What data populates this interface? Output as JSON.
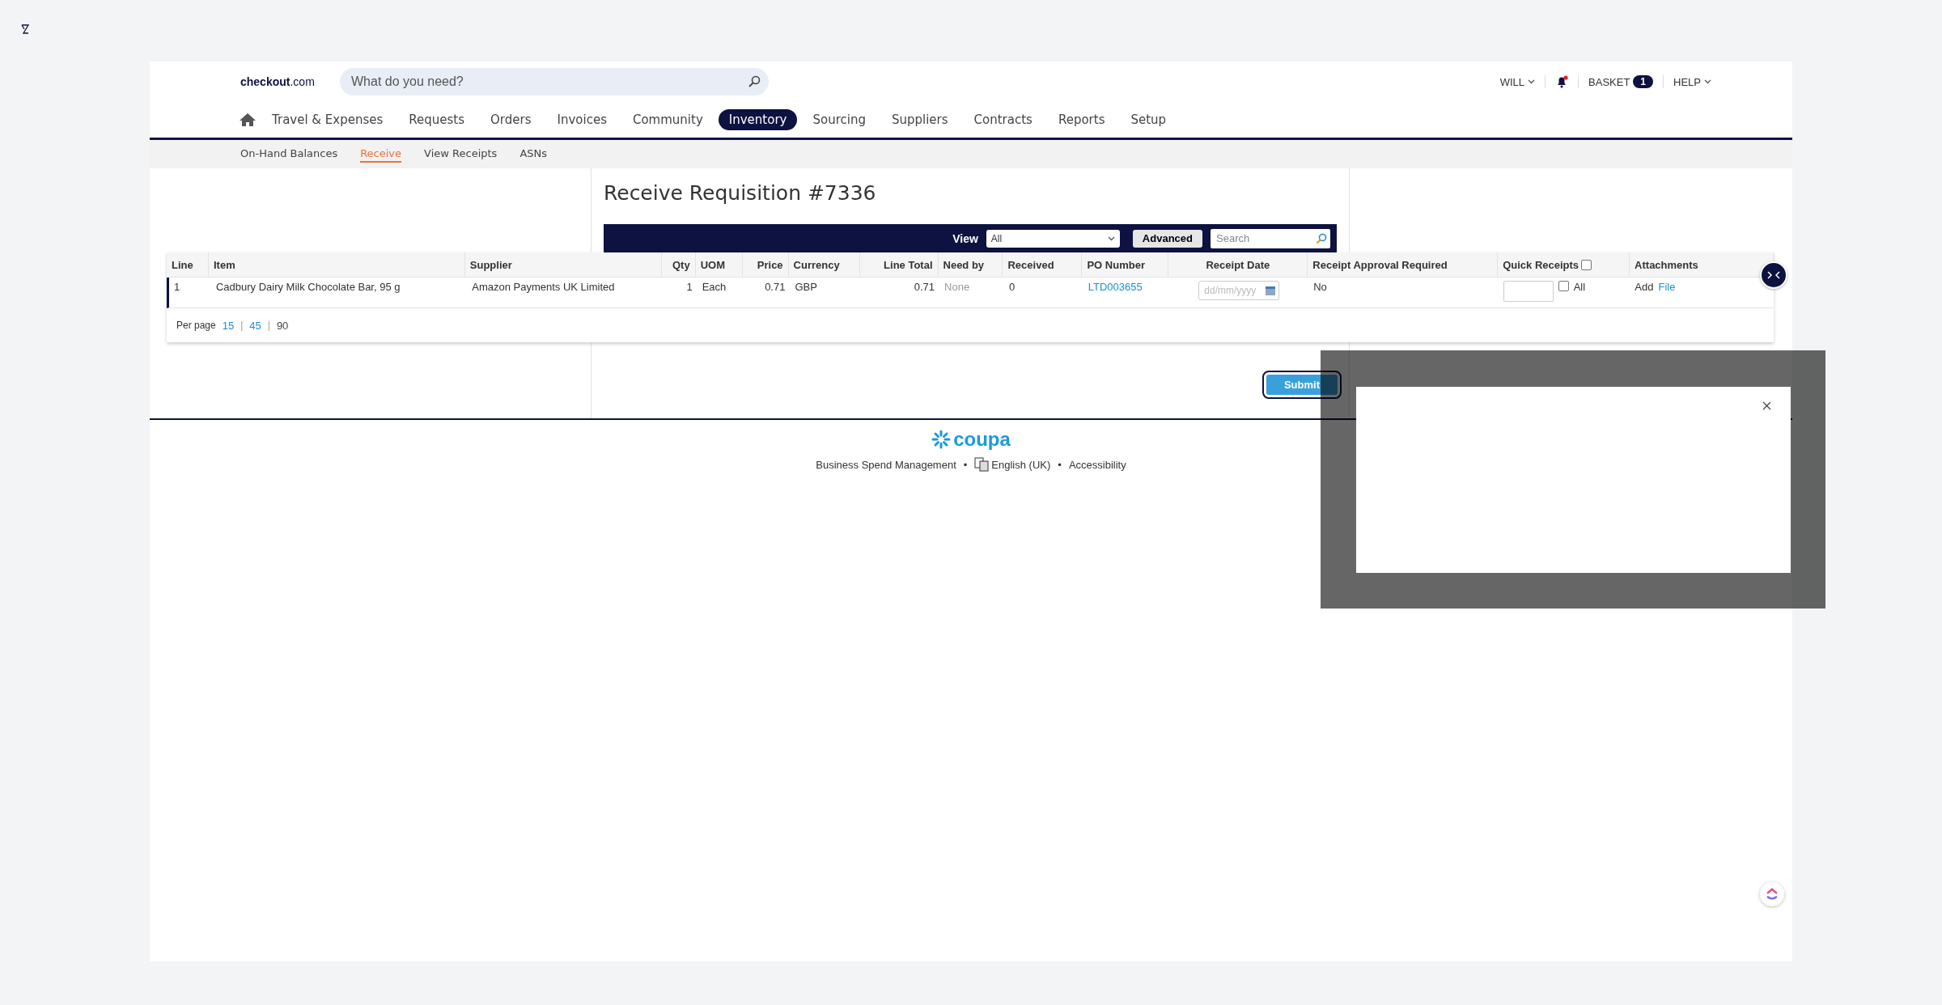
{
  "header": {
    "brand": "**checkout**.com",
    "search": {
      "placeholder": "What do you need?"
    },
    "user": "WILL",
    "notifications": {
      "unread": true
    },
    "basket": {
      "label": "BASKET",
      "count": "1"
    },
    "help": "HELP"
  },
  "nav": [
    {
      "label": "Travel & Expenses",
      "selected": false
    },
    {
      "label": "Requests",
      "selected": false
    },
    {
      "label": "Orders",
      "selected": false
    },
    {
      "label": "Invoices",
      "selected": false
    },
    {
      "label": "Community",
      "selected": false
    },
    {
      "label": "Inventory",
      "selected": true
    },
    {
      "label": "Sourcing",
      "selected": false
    },
    {
      "label": "Suppliers",
      "selected": false
    },
    {
      "label": "Contracts",
      "selected": false
    },
    {
      "label": "Reports",
      "selected": false
    },
    {
      "label": "Setup",
      "selected": false
    }
  ],
  "subnav": [
    {
      "label": "On-Hand Balances",
      "selected": false
    },
    {
      "label": "Receive",
      "selected": true
    },
    {
      "label": "View Receipts",
      "selected": false
    },
    {
      "label": "ASNs",
      "selected": false
    }
  ],
  "title": "Receive Requisition #7336",
  "view_bar": {
    "label": "View",
    "select": "All",
    "advanced": "Advanced",
    "search": {
      "placeholder": "Search"
    }
  },
  "table": {
    "columns": [
      {
        "label": "Line"
      },
      {
        "label": "Item"
      },
      {
        "label": "Supplier"
      },
      {
        "label": "Qty"
      },
      {
        "label": "UOM"
      },
      {
        "label": "Price"
      },
      {
        "label": "Currency"
      },
      {
        "label": "Line Total"
      },
      {
        "label": "Need by"
      },
      {
        "label": "Received"
      },
      {
        "label": "PO Number"
      },
      {
        "label": "Receipt Date"
      },
      {
        "label": "Receipt Approval Required"
      },
      {
        "label": "Quick Receipts",
        "checked": false
      },
      {
        "label": "Attachments"
      }
    ],
    "rows": [
      {
        "cells": [
          {
            "kind": "text",
            "text": "1"
          },
          {
            "kind": "text",
            "text": "Cadbury Dairy Milk Chocolate Bar, 95 g"
          },
          {
            "kind": "text",
            "text": "Amazon Payments UK Limited"
          },
          {
            "kind": "text",
            "text": "1"
          },
          {
            "kind": "text",
            "text": "Each"
          },
          {
            "kind": "text",
            "text": "0.71"
          },
          {
            "kind": "text",
            "text": "GBP"
          },
          {
            "kind": "text",
            "text": "0.71"
          },
          {
            "kind": "muted",
            "text": "None"
          },
          {
            "kind": "text",
            "text": "0"
          },
          {
            "kind": "link",
            "text": "LTD003655"
          },
          {
            "kind": "date",
            "placeholder": "dd/mm/yyyy"
          },
          {
            "kind": "text",
            "text": "No"
          },
          {
            "kind": "quick",
            "label": "All",
            "checked": false
          },
          {
            "kind": "attach",
            "text": "Add",
            "link": "File"
          }
        ]
      }
    ],
    "per_page": {
      "label": "Per page",
      "separator": "|",
      "options": [
        {
          "label": "15",
          "selected": false
        },
        {
          "label": "45",
          "selected": false
        },
        {
          "label": "90",
          "selected": true
        }
      ]
    }
  },
  "submit": "Submit",
  "footer": {
    "logo": "coupa",
    "separator": "•",
    "items": [
      {
        "kind": "text",
        "label": "Business Spend Management"
      },
      {
        "kind": "language",
        "label": "English (UK)"
      },
      {
        "kind": "text",
        "label": "Accessibility"
      }
    ]
  }
}
